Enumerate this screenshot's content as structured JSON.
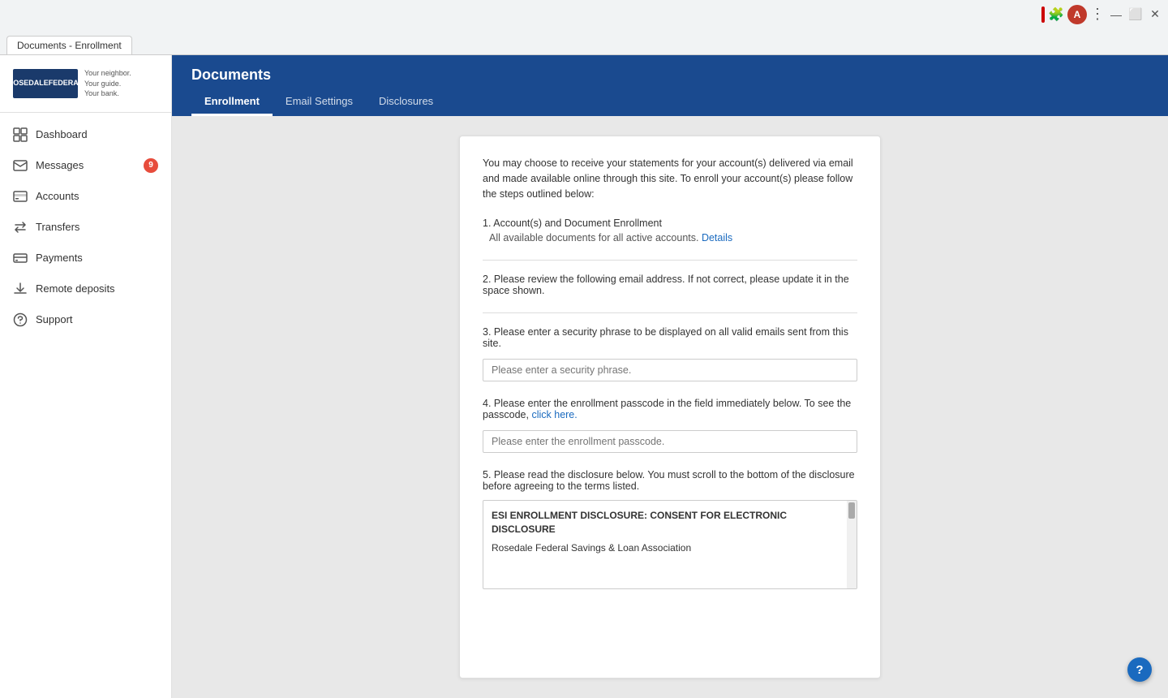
{
  "browser": {
    "tab_label": "Documents - Enrollment",
    "controls": {
      "minimize": "—",
      "maximize": "⬜",
      "close": "✕"
    },
    "extensions": {
      "avatar_label": "A"
    }
  },
  "sidebar": {
    "logo": {
      "line1": "ROSEDALE",
      "line2": "FEDERAL",
      "tagline1": "Your neighbor.",
      "tagline2": "Your guide.",
      "tagline3": "Your bank."
    },
    "nav_items": [
      {
        "id": "dashboard",
        "label": "Dashboard",
        "badge": null
      },
      {
        "id": "messages",
        "label": "Messages",
        "badge": "9"
      },
      {
        "id": "accounts",
        "label": "Accounts",
        "badge": null
      },
      {
        "id": "transfers",
        "label": "Transfers",
        "badge": null
      },
      {
        "id": "payments",
        "label": "Payments",
        "badge": null
      },
      {
        "id": "remote-deposits",
        "label": "Remote deposits",
        "badge": null
      },
      {
        "id": "support",
        "label": "Support",
        "badge": null
      }
    ]
  },
  "header": {
    "title": "Documents",
    "tabs": [
      {
        "id": "enrollment",
        "label": "Enrollment",
        "active": true
      },
      {
        "id": "email-settings",
        "label": "Email Settings",
        "active": false
      },
      {
        "id": "disclosures",
        "label": "Disclosures",
        "active": false
      }
    ]
  },
  "content": {
    "intro_text": "You may choose to receive your statements for your account(s) delivered via email and made available online through this site. To enroll your account(s) please follow the steps outlined below:",
    "steps": [
      {
        "number": "1.",
        "title": "Account(s) and Document Enrollment",
        "sub_text": "All available documents for all active accounts.",
        "link_text": "Details",
        "has_divider": true
      },
      {
        "number": "2.",
        "title": "Please review the following email address. If not correct, please update it in the space shown.",
        "has_divider": true
      },
      {
        "number": "3.",
        "title": "Please enter a security phrase to be displayed on all valid emails sent from this site.",
        "input_placeholder": "Please enter a security phrase.",
        "has_divider": false
      },
      {
        "number": "4.",
        "title": "Please enter the enrollment passcode in the field immediately below. To see the passcode,",
        "link_text": "click here.",
        "input_placeholder": "Please enter the enrollment passcode.",
        "has_divider": false
      },
      {
        "number": "5.",
        "title": "Please read the disclosure below. You must scroll to the bottom of the disclosure before agreeing to the terms listed.",
        "has_divider": false
      }
    ],
    "disclosure": {
      "title": "ESI ENROLLMENT DISCLOSURE:  CONSENT FOR ELECTRONIC DISCLOSURE",
      "body_text": "Rosedale Federal Savings & Loan Association"
    }
  },
  "help": {
    "label": "?"
  }
}
